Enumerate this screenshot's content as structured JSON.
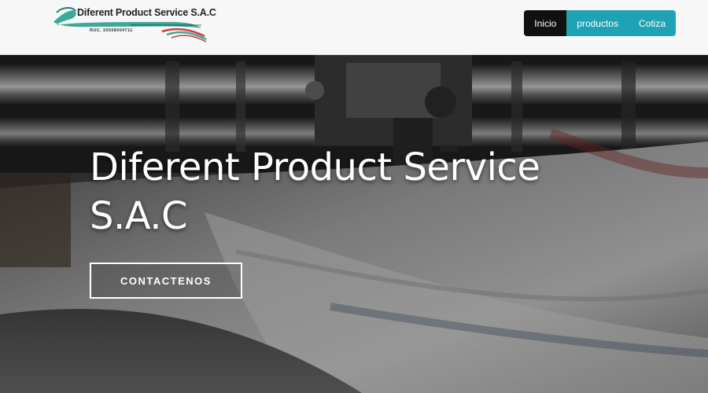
{
  "header": {
    "logo": {
      "title": "Diferent Product Service S.A.C",
      "ruc": "RUC. 20508004711"
    },
    "nav": {
      "items": [
        {
          "label": "Inicio",
          "active": true
        },
        {
          "label": "productos",
          "active": false
        },
        {
          "label": "Cotiza",
          "active": false
        }
      ]
    }
  },
  "hero": {
    "title": "Diferent Product Service S.A.C",
    "cta_label": "CONTACTENOS"
  },
  "colors": {
    "nav_accent": "#1fa3b4",
    "nav_active": "#111111",
    "header_bg": "#f7f7f7",
    "logo_teal": "#3aa99a",
    "logo_red": "#d23a3a"
  }
}
